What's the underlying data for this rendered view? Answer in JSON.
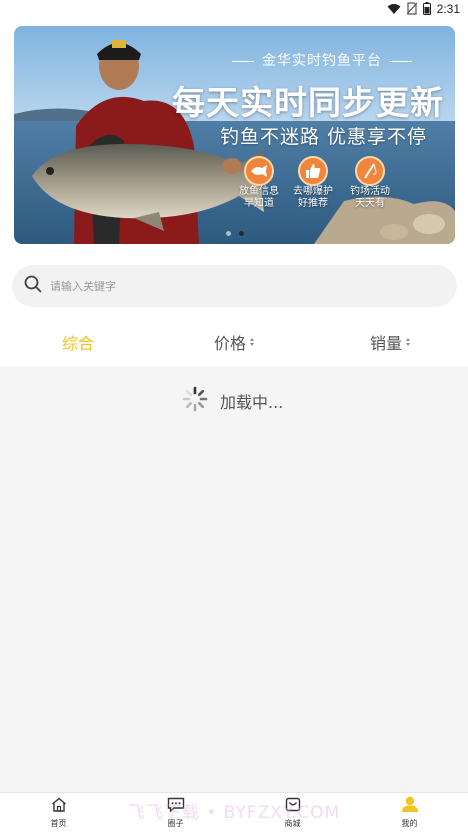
{
  "status_bar": {
    "time": "2:31",
    "icons": [
      "wifi-icon",
      "no-sim-icon",
      "battery-icon"
    ]
  },
  "banner": {
    "subtitle": "金华实时钓鱼平台",
    "title": "每天实时同步更新",
    "slogan": "钓鱼不迷路 优惠享不停",
    "features": [
      {
        "icon": "fish-icon",
        "line1": "放鱼信息",
        "line2": "早知道"
      },
      {
        "icon": "thumbs-up-icon",
        "line1": "去哪爆护",
        "line2": "好推荐"
      },
      {
        "icon": "fishing-rod-icon",
        "line1": "钓场活动",
        "line2": "天天有"
      }
    ],
    "slide_count": 2,
    "active_slide": 2
  },
  "search": {
    "placeholder": "请输入关键字"
  },
  "sort_tabs": [
    {
      "label": "综合",
      "active": true
    },
    {
      "label": "价格",
      "active": false
    },
    {
      "label": "销量",
      "active": false
    }
  ],
  "loading": {
    "text": "加载中..."
  },
  "tabbar": [
    {
      "icon": "home-icon",
      "label": "首页",
      "active": false
    },
    {
      "icon": "chat-icon",
      "label": "圈子",
      "active": false
    },
    {
      "icon": "shop-icon",
      "label": "商城",
      "active": false
    },
    {
      "icon": "user-icon",
      "label": "我的",
      "active": true
    }
  ],
  "watermark": "飞飞下载 • BYFZXY.COM",
  "colors": {
    "accent": "#f2c31b",
    "feature_orange": "#f0863c",
    "background": "#f5f5f5"
  }
}
